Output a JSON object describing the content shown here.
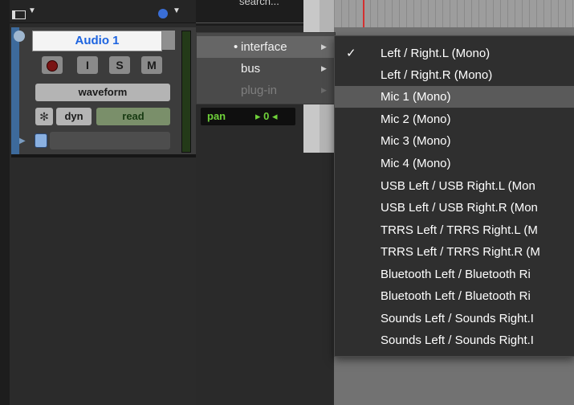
{
  "header": {
    "search_text": "search..."
  },
  "track": {
    "name": "Audio 1",
    "input_button": "I",
    "solo_button": "S",
    "mute_button": "M",
    "view": "waveform",
    "dyn_label": "dyn",
    "automation": "read",
    "pan_label": "pan",
    "pan_value": "0"
  },
  "submenu": {
    "items": [
      {
        "label": "interface",
        "selected": true
      },
      {
        "label": "bus"
      },
      {
        "label": "plug-in",
        "disabled": true
      }
    ]
  },
  "menu": {
    "items": [
      {
        "label": "Left / Right.L (Mono)",
        "checked": true
      },
      {
        "label": "Left / Right.R (Mono)"
      },
      {
        "label": "Mic 1 (Mono)",
        "highlighted": true
      },
      {
        "label": "Mic 2 (Mono)"
      },
      {
        "label": "Mic 3 (Mono)"
      },
      {
        "label": "Mic 4 (Mono)"
      },
      {
        "label": "USB Left / USB Right.L (Mon"
      },
      {
        "label": "USB Left / USB Right.R (Mon"
      },
      {
        "label": "TRRS Left / TRRS Right.L (M"
      },
      {
        "label": "TRRS Left / TRRS Right.R (M"
      },
      {
        "label": "Bluetooth Left / Bluetooth Ri"
      },
      {
        "label": "Bluetooth Left / Bluetooth Ri"
      },
      {
        "label": "Sounds Left / Sounds Right.I"
      },
      {
        "label": "Sounds Left / Sounds Right.I"
      }
    ]
  },
  "icons": {
    "check": "check-icon",
    "chevron": "chevron-right-icon",
    "clock": "clock-icon"
  },
  "colors": {
    "track_name": "#1d64e0",
    "pan_text": "#6fd13a",
    "menu_highlight": "#5a5a5a",
    "playhead": "#d43030"
  }
}
